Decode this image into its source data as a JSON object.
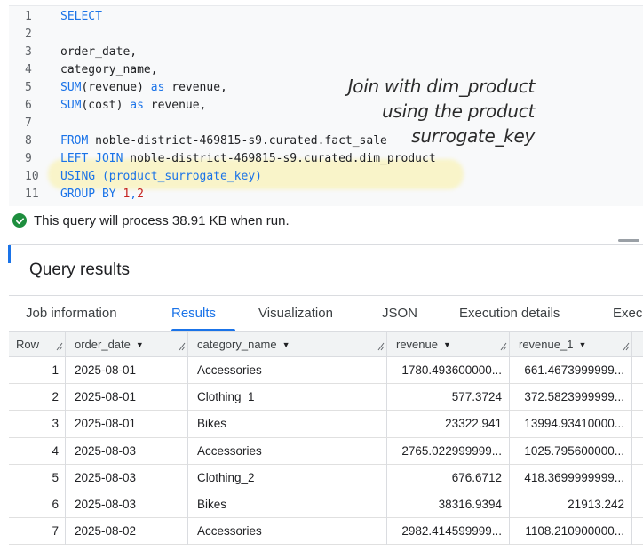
{
  "editor": {
    "lines": [
      {
        "n": "1",
        "parts": [
          {
            "t": "SELECT",
            "c": "kw"
          }
        ]
      },
      {
        "n": "2",
        "parts": []
      },
      {
        "n": "3",
        "parts": [
          {
            "t": "order_date,",
            "c": ""
          }
        ]
      },
      {
        "n": "4",
        "parts": [
          {
            "t": "category_name,",
            "c": ""
          }
        ]
      },
      {
        "n": "5",
        "parts": [
          {
            "t": "SUM",
            "c": "kw"
          },
          {
            "t": "(revenue) ",
            "c": ""
          },
          {
            "t": "as",
            "c": "kw"
          },
          {
            "t": " revenue,",
            "c": ""
          }
        ]
      },
      {
        "n": "6",
        "parts": [
          {
            "t": "SUM",
            "c": "kw"
          },
          {
            "t": "(cost) ",
            "c": ""
          },
          {
            "t": "as",
            "c": "kw"
          },
          {
            "t": " revenue,",
            "c": ""
          }
        ]
      },
      {
        "n": "7",
        "parts": []
      },
      {
        "n": "8",
        "parts": [
          {
            "t": "FROM",
            "c": "kw"
          },
          {
            "t": " noble-district-469815-s9.curated.fact_sale",
            "c": ""
          }
        ]
      },
      {
        "n": "9",
        "parts": [
          {
            "t": "LEFT JOIN",
            "c": "kw"
          },
          {
            "t": " noble-district-469815-s9.curated.dim_product",
            "c": ""
          }
        ]
      },
      {
        "n": "10",
        "parts": [
          {
            "t": "USING",
            "c": "kw"
          },
          {
            "t": " (product_surrogate_key)",
            "c": "kw"
          }
        ]
      },
      {
        "n": "11",
        "parts": [
          {
            "t": "GROUP BY",
            "c": "kw"
          },
          {
            "t": " ",
            "c": ""
          },
          {
            "t": "1",
            "c": "num"
          },
          {
            "t": ",",
            "c": "kw"
          },
          {
            "t": "2",
            "c": "num"
          }
        ]
      }
    ],
    "annotation": [
      "Join with dim_product",
      "using the product",
      "surrogate_key"
    ]
  },
  "status": {
    "text": "This query will process 38.91 KB when run.",
    "icon": "check-circle-icon",
    "color": "#1e8e3e"
  },
  "results": {
    "title": "Query results",
    "tabs": [
      "Job information",
      "Results",
      "Visualization",
      "JSON",
      "Execution details",
      "Exec"
    ],
    "active_tab": "Results",
    "columns": [
      "Row",
      "order_date",
      "category_name",
      "revenue",
      "revenue_1"
    ],
    "rows": [
      [
        "1",
        "2025-08-01",
        "Accessories",
        "1780.493600000...",
        "661.4673999999..."
      ],
      [
        "2",
        "2025-08-01",
        "Clothing_1",
        "577.3724",
        "372.5823999999..."
      ],
      [
        "3",
        "2025-08-01",
        "Bikes",
        "23322.941",
        "13994.93410000..."
      ],
      [
        "4",
        "2025-08-03",
        "Accessories",
        "2765.022999999...",
        "1025.795600000..."
      ],
      [
        "5",
        "2025-08-03",
        "Clothing_2",
        "676.6712",
        "418.3699999999..."
      ],
      [
        "6",
        "2025-08-03",
        "Bikes",
        "38316.9394",
        "21913.242"
      ],
      [
        "7",
        "2025-08-02",
        "Accessories",
        "2982.414599999...",
        "1108.210900000..."
      ]
    ]
  },
  "colors": {
    "keyword": "#1a73e8",
    "number": "#c5221f",
    "active_tab": "#1a73e8",
    "highlight": "#faf0a0"
  }
}
